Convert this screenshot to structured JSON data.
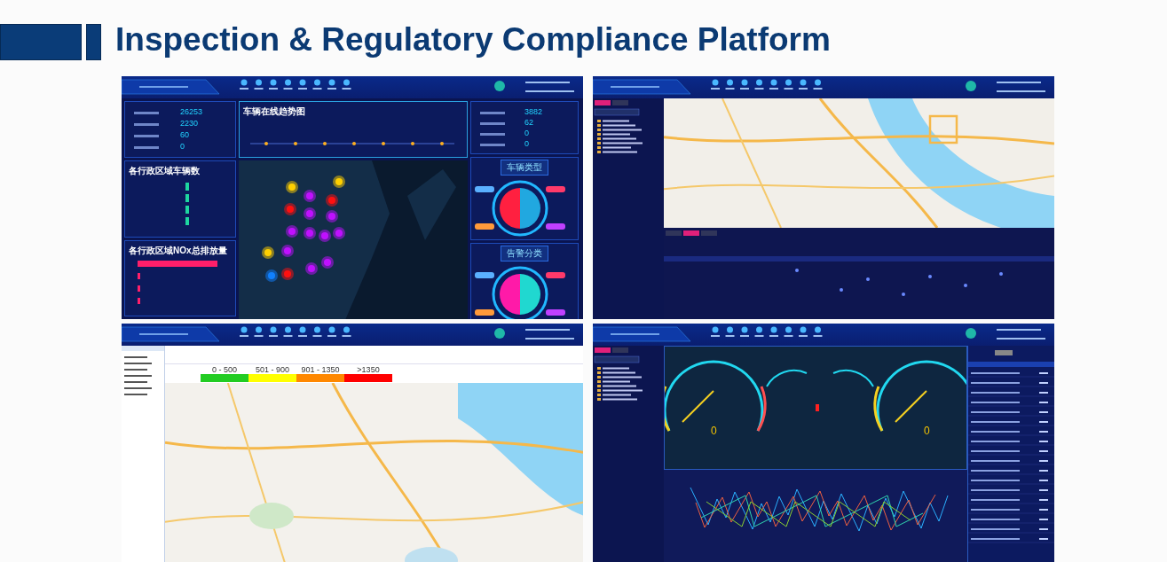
{
  "header": {
    "title": "Inspection & Regulatory Compliance Platform"
  },
  "screenshots": [
    {
      "kind": "overview",
      "trend_title": "车辆在线趋势图",
      "left_stats": [
        "26253",
        "2230",
        "60",
        "0"
      ],
      "right_stats": [
        "3882",
        "62",
        "0",
        "0"
      ],
      "region_chart_titles": [
        "各行政区域车辆数",
        "各行政区域NOx总排放量"
      ],
      "vehicle_type_title": "车辆类型",
      "alarm_title": "告警分类"
    },
    {
      "kind": "location_map"
    },
    {
      "kind": "heat_map",
      "legend": [
        {
          "label": "0 - 500",
          "color": "#22cc22"
        },
        {
          "label": "501 - 900",
          "color": "#ffff00"
        },
        {
          "label": "901 - 1350",
          "color": "#ff8800"
        },
        {
          "label": ">1350",
          "color": "#ff0000"
        }
      ]
    },
    {
      "kind": "realtime",
      "gauge_readings": [
        "0",
        "0"
      ]
    }
  ]
}
